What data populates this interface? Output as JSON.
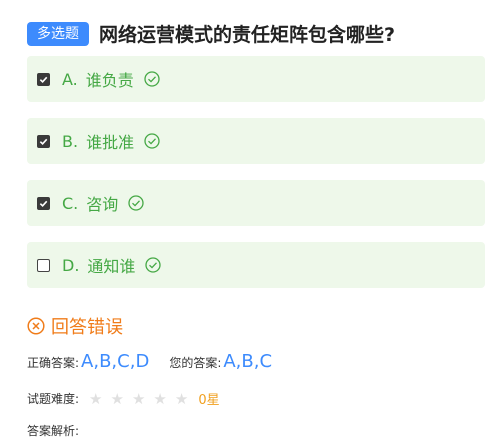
{
  "question": {
    "type_badge": "多选题",
    "title": "网络运营模式的责任矩阵包含哪些?"
  },
  "options": [
    {
      "letter": "A.",
      "text": "谁负责",
      "checked": true
    },
    {
      "letter": "B.",
      "text": "谁批准",
      "checked": true
    },
    {
      "letter": "C.",
      "text": "咨询",
      "checked": true
    },
    {
      "letter": "D.",
      "text": "通知谁",
      "checked": false
    }
  ],
  "result": {
    "text": "回答错误",
    "icon": "circle-x-icon"
  },
  "answer": {
    "correct_label": "正确答案:",
    "correct_value": "A,B,C,D",
    "mine_label": "您的答案:",
    "mine_value": "A,B,C"
  },
  "difficulty": {
    "label": "试题难度:",
    "stars_total": 5,
    "stars_filled": 0,
    "value": "0星"
  },
  "analysis": {
    "label": "答案解析:"
  },
  "colors": {
    "accent": "#3d8bfd",
    "option_bg": "#eef8ea",
    "option_text": "#45a845",
    "error": "#f07c1a",
    "difficulty": "#f0a020"
  }
}
